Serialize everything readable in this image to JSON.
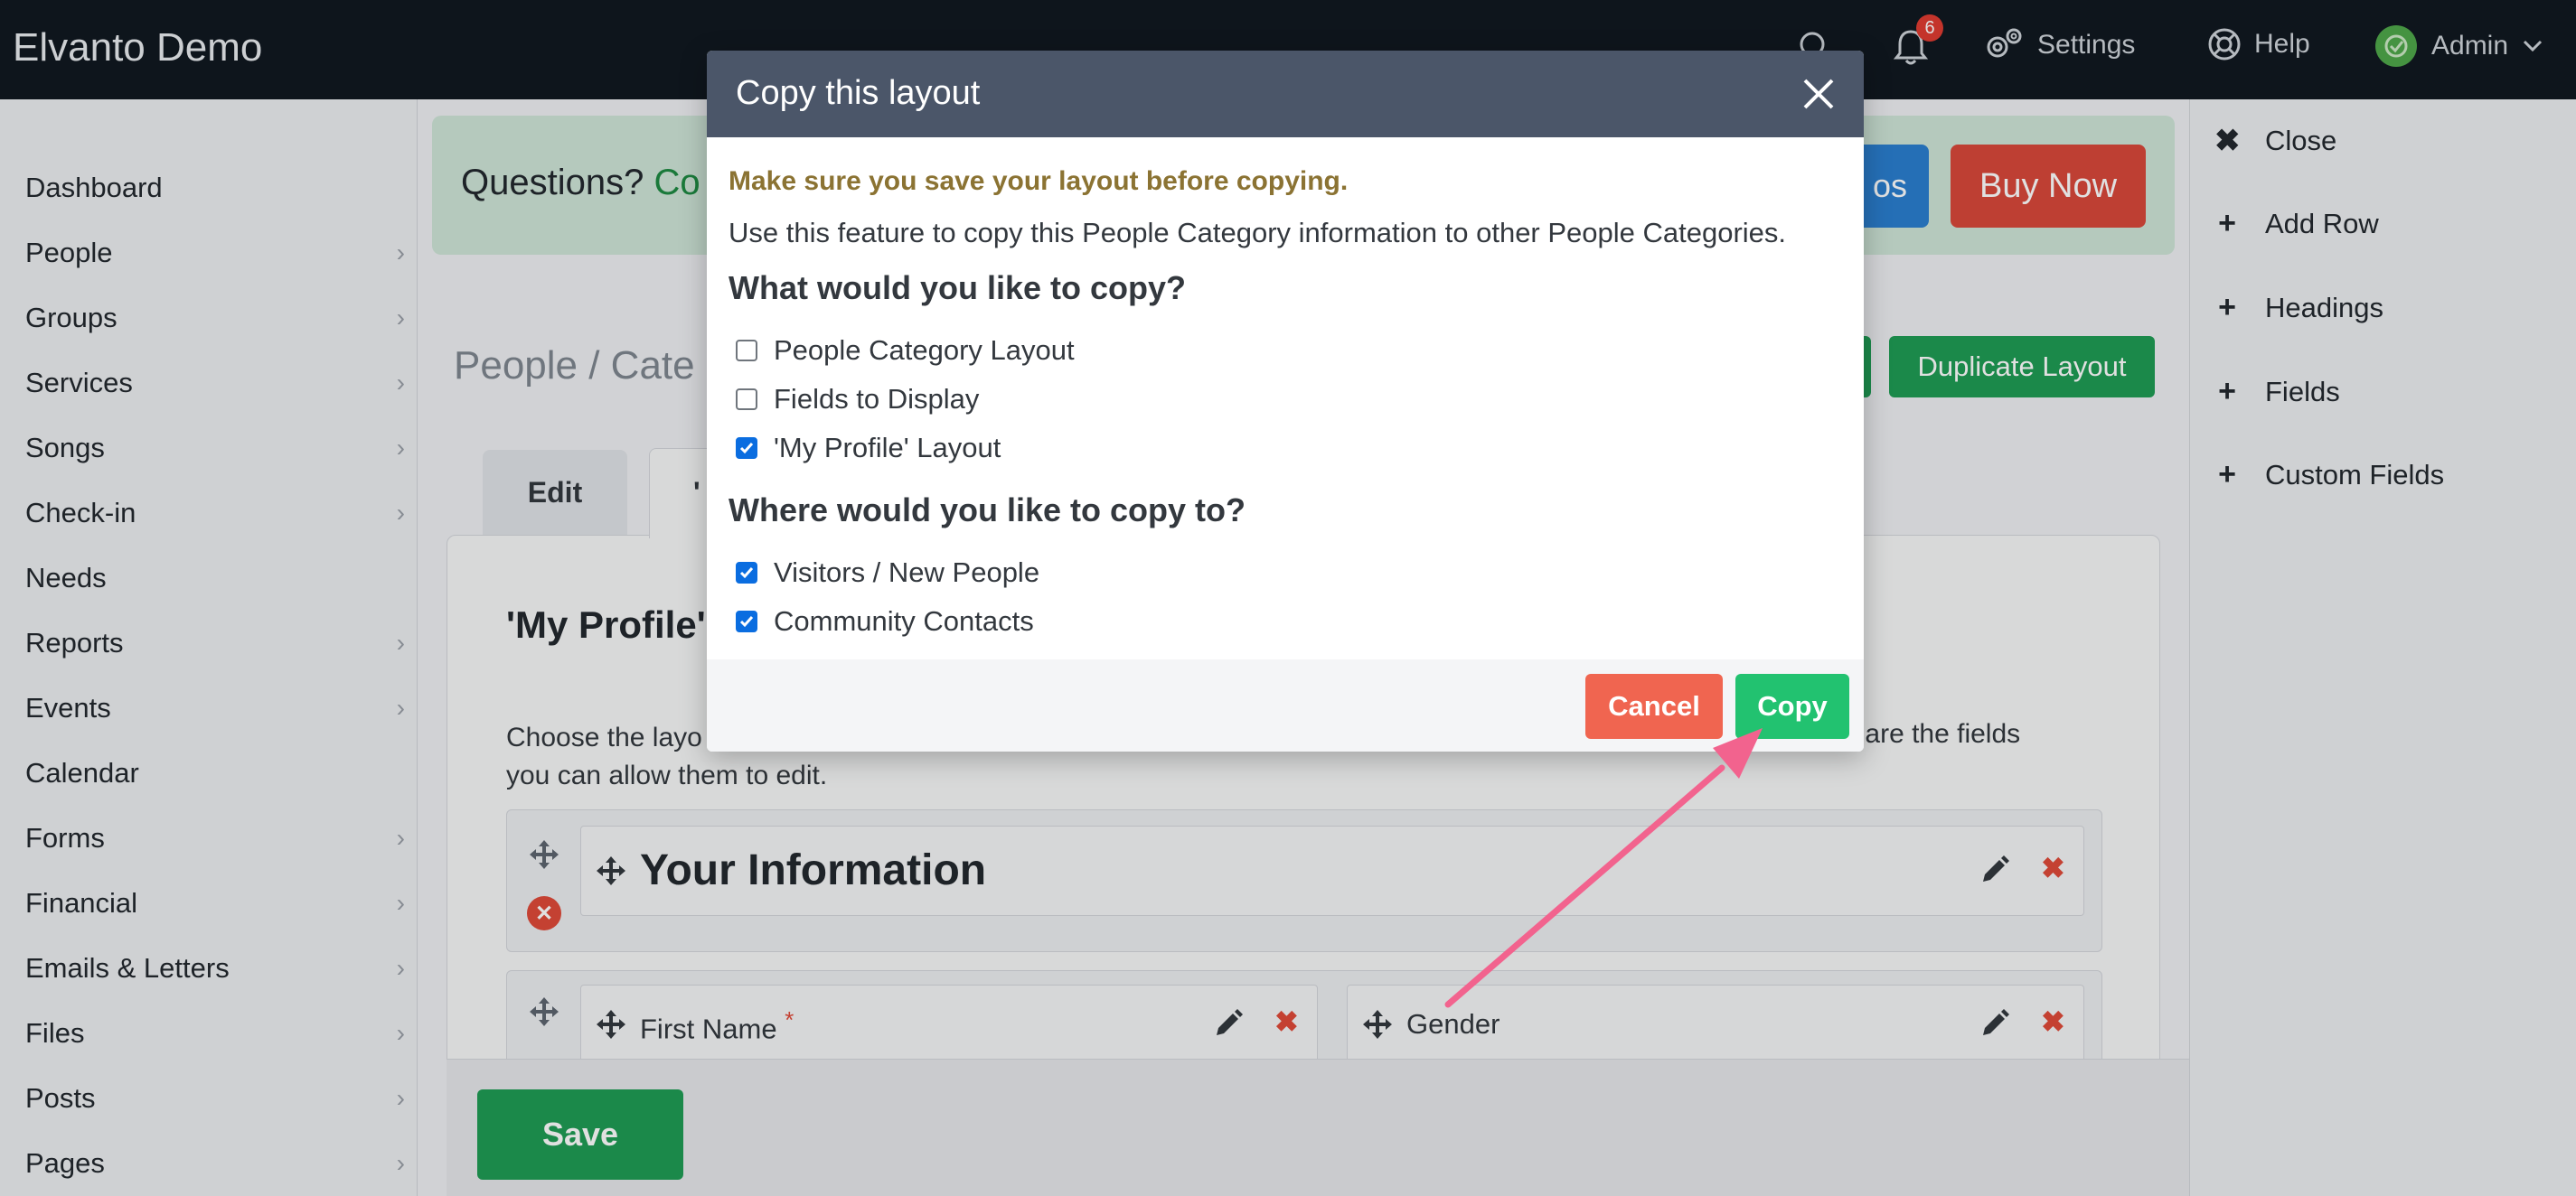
{
  "app": {
    "title": "Elvanto Demo"
  },
  "topbar": {
    "notification_count": "6",
    "settings_label": "Settings",
    "help_label": "Help",
    "admin_label": "Admin"
  },
  "sidebar": {
    "items": [
      {
        "label": "Dashboard",
        "chevron": false
      },
      {
        "label": "People",
        "chevron": true
      },
      {
        "label": "Groups",
        "chevron": true
      },
      {
        "label": "Services",
        "chevron": true
      },
      {
        "label": "Songs",
        "chevron": true
      },
      {
        "label": "Check-in",
        "chevron": true
      },
      {
        "label": "Needs",
        "chevron": false
      },
      {
        "label": "Reports",
        "chevron": true
      },
      {
        "label": "Events",
        "chevron": true
      },
      {
        "label": "Calendar",
        "chevron": false
      },
      {
        "label": "Forms",
        "chevron": true
      },
      {
        "label": "Financial",
        "chevron": true
      },
      {
        "label": "Emails & Letters",
        "chevron": true
      },
      {
        "label": "Files",
        "chevron": true
      },
      {
        "label": "Posts",
        "chevron": true
      },
      {
        "label": "Pages",
        "chevron": true
      }
    ]
  },
  "right_panel": {
    "close_label": "Close",
    "add_row_label": "Add Row",
    "headings_label": "Headings",
    "fields_label": "Fields",
    "custom_fields_label": "Custom Fields"
  },
  "banner": {
    "text": "Questions? ",
    "link_fragment": "Co",
    "blue_button_fragment": "os",
    "buy_now_label": "Buy Now"
  },
  "breadcrumb": {
    "text": "People  /  Cate"
  },
  "duplicate_layout_label": "Duplicate Layout",
  "tabs": {
    "edit_label": "Edit",
    "profile_fragment": "'"
  },
  "section": {
    "title": "'My Profile'",
    "desc_left_line1": "Choose the layo",
    "desc_left_line2": "you can allow them to edit.",
    "desc_right": "hese are the fields"
  },
  "layout_rows": {
    "heading_text": "Your Information",
    "first_name_label": "First Name",
    "required_mark": "*",
    "gender_label": "Gender"
  },
  "save_label": "Save",
  "modal": {
    "title": "Copy this layout",
    "warning": "Make sure you save your layout before copying.",
    "description": "Use this feature to copy this People Category information to other People Categories.",
    "copy_what_heading": "What would you like to copy?",
    "copy_what_options": [
      {
        "label": "People Category Layout",
        "checked": false
      },
      {
        "label": "Fields to Display",
        "checked": false
      },
      {
        "label": "'My Profile' Layout",
        "checked": true
      }
    ],
    "copy_to_heading": "Where would you like to copy to?",
    "copy_to_options": [
      {
        "label": "Visitors / New People",
        "checked": true
      },
      {
        "label": "Community Contacts",
        "checked": true
      }
    ],
    "cancel_label": "Cancel",
    "copy_label": "Copy"
  },
  "colors": {
    "topbar_bg": "#111820",
    "modal_header_bg": "#4b5669",
    "warning_text": "#8b7333",
    "cancel_button": "#f06550",
    "copy_button": "#22c270",
    "save_button": "#1f9c55",
    "buy_now": "#d9483b",
    "annotation_arrow": "#f2638e"
  }
}
